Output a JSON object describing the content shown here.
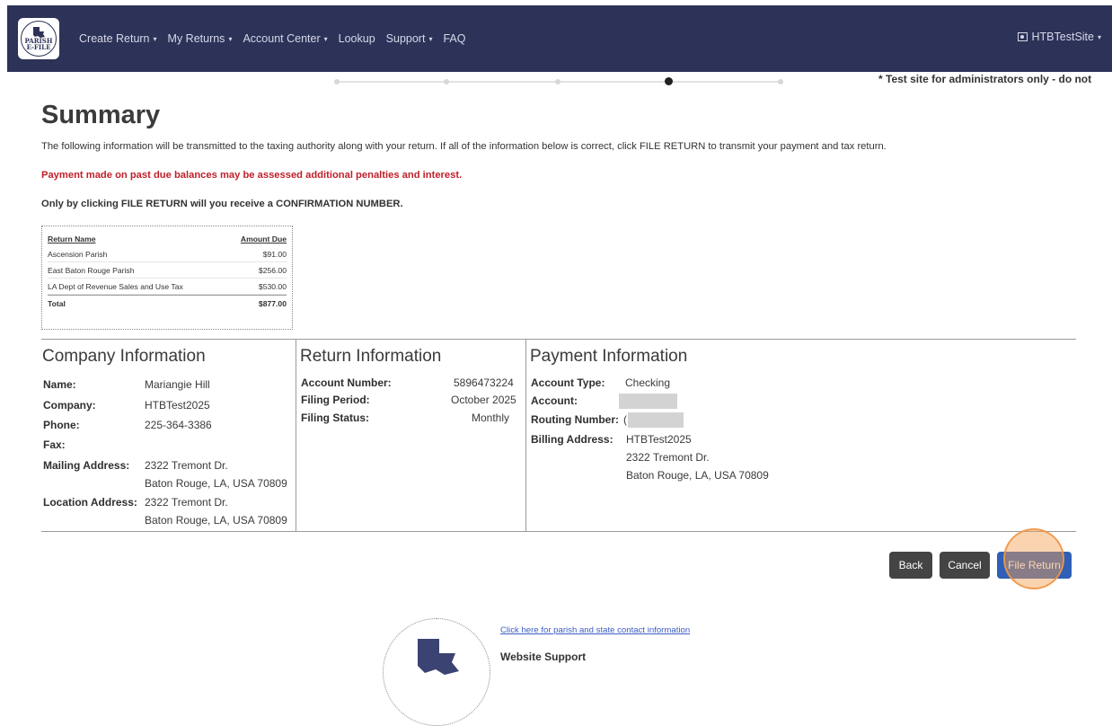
{
  "nav": {
    "logo_line1": "PARISH",
    "logo_line2": "E-FILE",
    "items": [
      {
        "label": "Create Return",
        "caret": "▾"
      },
      {
        "label": "My Returns",
        "caret": "▾"
      },
      {
        "label": "Account Center",
        "caret": "▾"
      },
      {
        "label": "Lookup",
        "caret": ""
      },
      {
        "label": "Support",
        "caret": "▾"
      },
      {
        "label": "FAQ",
        "caret": ""
      }
    ],
    "user_label": "HTBTestSite",
    "user_caret": "▾"
  },
  "stepper": {
    "current_step": 4,
    "total_steps": 5
  },
  "test_notice": "* Test site for administrators only - do not",
  "page": {
    "title": "Summary",
    "intro": "The following information will be transmitted to the taxing authority along with your return. If all of the information below is correct, click FILE RETURN to transmit your payment and tax return.",
    "warning": "Payment made on past due balances may be assessed additional penalties and interest.",
    "confirm_note": "Only by clicking FILE RETURN will you receive a CONFIRMATION NUMBER."
  },
  "amounts": {
    "headers": {
      "name": "Return Name",
      "amount": "Amount Due"
    },
    "rows": [
      {
        "name": "Ascension Parish",
        "amount": "$91.00"
      },
      {
        "name": "East Baton Rouge Parish",
        "amount": "$256.00"
      },
      {
        "name": "LA Dept of Revenue Sales and Use Tax",
        "amount": "$530.00"
      }
    ],
    "total": {
      "name": "Total",
      "amount": "$877.00"
    }
  },
  "company": {
    "title": "Company Information",
    "name_label": "Name:",
    "name": "Mariangie Hill",
    "company_label": "Company:",
    "company": "HTBTest2025",
    "phone_label": "Phone:",
    "phone": "225-364-3386",
    "fax_label": "Fax:",
    "mailing_label": "Mailing Address:",
    "mailing_line1": "2322 Tremont Dr.",
    "mailing_line2": "Baton Rouge, LA, USA 70809",
    "location_label": "Location Address:",
    "location_line1": "2322 Tremont Dr.",
    "location_line2": "Baton Rouge, LA, USA 70809"
  },
  "return_info": {
    "title": "Return Information",
    "account_label": "Account Number:",
    "account": "5896473224",
    "period_label": "Filing Period:",
    "period": "October 2025",
    "status_label": "Filing Status:",
    "status": "Monthly"
  },
  "payment": {
    "title": "Payment Information",
    "type_label": "Account Type:",
    "type": "Checking",
    "account_label": "Account:",
    "routing_label": "Routing Number:",
    "routing_prefix": "(",
    "billing_label": "Billing Address:",
    "billing_line1": "HTBTest2025",
    "billing_line2": "2322 Tremont Dr.",
    "billing_line3": "Baton Rouge, LA, USA 70809"
  },
  "buttons": {
    "back": "Back",
    "cancel": "Cancel",
    "file": "File Return"
  },
  "footer": {
    "contact_link": "Click here for parish and state contact information",
    "support_title": "Website Support"
  },
  "colors": {
    "navbar": "#2d3258",
    "warning": "#c0202a",
    "primary": "#2f5fb6",
    "secondary": "#444444",
    "link": "#3a5cc6"
  }
}
